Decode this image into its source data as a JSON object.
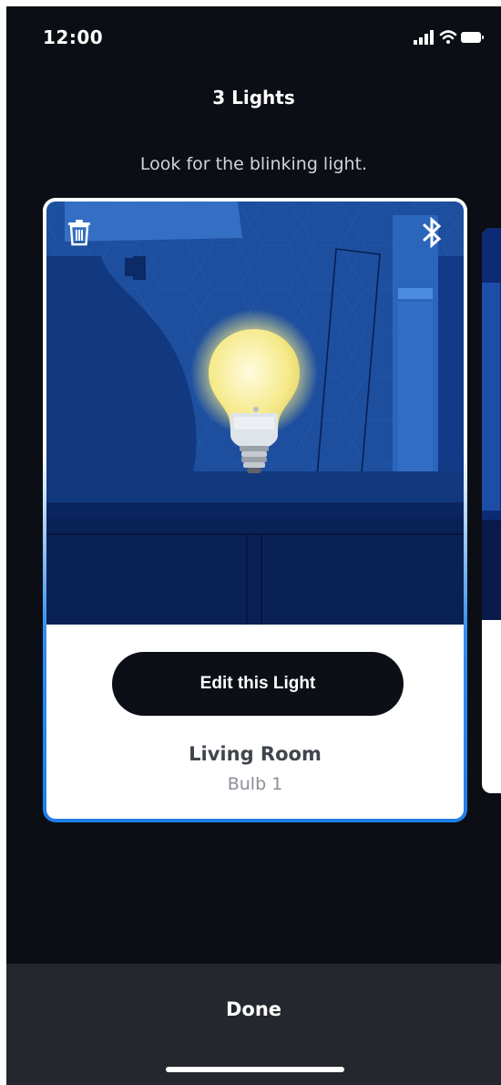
{
  "status_bar": {
    "time": "12:00",
    "signal_icon": "signal-bars-icon",
    "wifi_icon": "wifi-icon",
    "battery_icon": "battery-icon"
  },
  "header": {
    "title": "3 Lights",
    "subtitle": "Look for the blinking light."
  },
  "card": {
    "delete_icon": "trash-icon",
    "bluetooth_icon": "bluetooth-icon",
    "image": "blinking-light-bulb-illustration",
    "edit_label": "Edit this Light",
    "room_name": "Living Room",
    "bulb_name": "Bulb 1"
  },
  "footer": {
    "done_label": "Done"
  },
  "colors": {
    "background": "#0b0e14",
    "accent": "#2f8cf0",
    "button": "#0c0f16",
    "bottom_bar": "#24272d"
  }
}
